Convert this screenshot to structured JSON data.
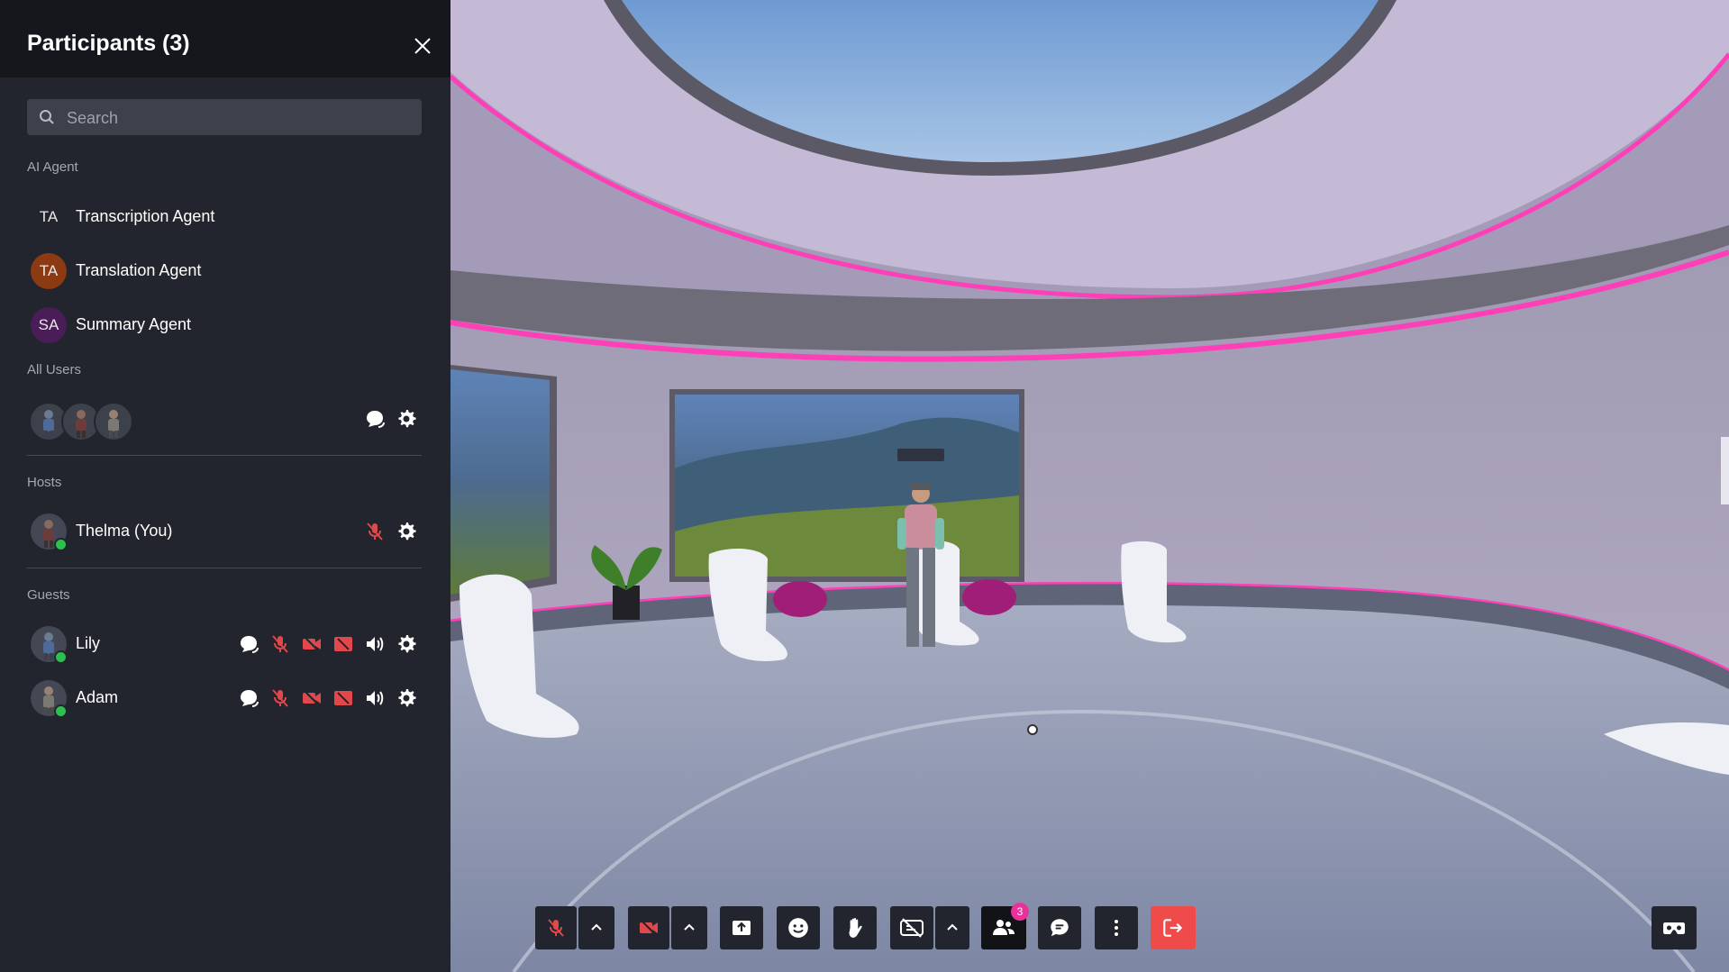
{
  "panel": {
    "title": "Participants (3)",
    "search_placeholder": "Search",
    "search_value": ""
  },
  "sections": {
    "ai_agent": "AI Agent",
    "all_users": "All Users",
    "hosts": "Hosts",
    "guests": "Guests"
  },
  "ai_agents": [
    {
      "initials": "TA",
      "name": "Transcription Agent",
      "color": "#22252d"
    },
    {
      "initials": "TA",
      "name": "Translation Agent",
      "color": "#8b3a12"
    },
    {
      "initials": "SA",
      "name": "Summary Agent",
      "color": "#4a1c58"
    }
  ],
  "hosts": [
    {
      "name": "Thelma (You)",
      "online": true
    }
  ],
  "guests": [
    {
      "name": "Lily",
      "online": true
    },
    {
      "name": "Adam",
      "online": true
    }
  ],
  "toolbar": {
    "participants_count": "3"
  },
  "colors": {
    "accent_pink": "#e8329a",
    "muted_red": "#e0484c",
    "leave_red": "#ef4b4b",
    "online_green": "#2fbf4f",
    "sidebar_bg": "#22252d",
    "header_bg": "#15171c"
  }
}
